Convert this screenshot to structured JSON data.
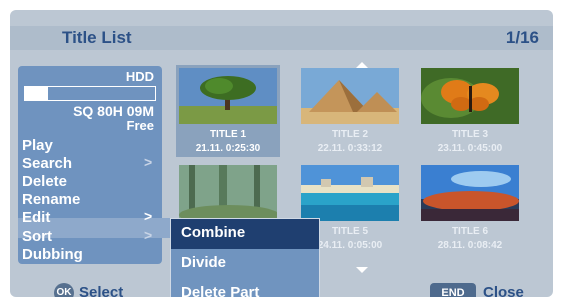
{
  "header": {
    "title": "Title List",
    "page": "1/16"
  },
  "disc": {
    "type": "HDD",
    "remaining": "SQ 80H 09M",
    "free_label": "Free",
    "used_fraction": 0.18
  },
  "menu": {
    "items": [
      "Play",
      "Search",
      "Delete",
      "Rename",
      "Edit",
      "Sort",
      "Dubbing"
    ],
    "arrow": ">"
  },
  "submenu": {
    "items": [
      "Combine",
      "Divide",
      "Delete Part"
    ],
    "active": "Combine"
  },
  "titles": [
    {
      "name": "TITLE 1",
      "date": "21.11.  0:25:30",
      "scene": "tree"
    },
    {
      "name": "TITLE 2",
      "date": "22.11.  0:33:12",
      "scene": "pyramids"
    },
    {
      "name": "TITLE 3",
      "date": "23.11.  0:45:00",
      "scene": "butterfly"
    },
    {
      "name": "",
      "date": "",
      "scene": "forest"
    },
    {
      "name": "TITLE 5",
      "date": "24.11.  0:05:00",
      "scene": "beach"
    },
    {
      "name": "TITLE 6",
      "date": "28.11.  0:08:42",
      "scene": "sunset"
    }
  ],
  "footer": {
    "ok_button": "OK",
    "select_label": "Select",
    "end_button": "END",
    "close_label": "Close"
  },
  "colors": {
    "background": "#bcc7d3",
    "panel": "#6f93bf",
    "accent_text": "#2c5187",
    "active_submenu": "#1f3f70"
  }
}
